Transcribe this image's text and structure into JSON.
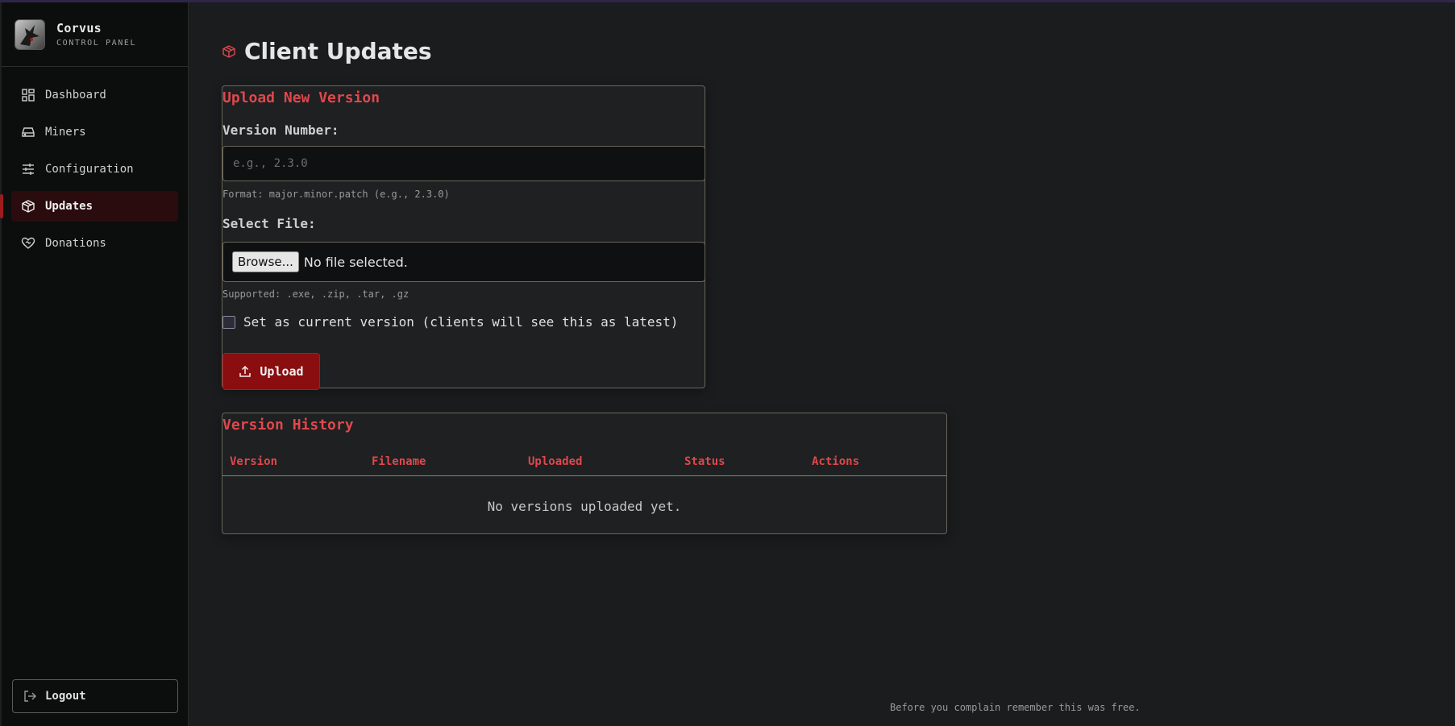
{
  "brand": {
    "name": "Corvus",
    "subtitle": "CONTROL PANEL"
  },
  "sidebar": {
    "items": [
      {
        "label": "Dashboard",
        "icon": "dashboard-icon",
        "active": false
      },
      {
        "label": "Miners",
        "icon": "drive-icon",
        "active": false
      },
      {
        "label": "Configuration",
        "icon": "sliders-icon",
        "active": false
      },
      {
        "label": "Updates",
        "icon": "package-icon",
        "active": true
      },
      {
        "label": "Donations",
        "icon": "heart-handshake-icon",
        "active": false
      }
    ],
    "logout_label": "Logout"
  },
  "page": {
    "title": "Client Updates"
  },
  "upload": {
    "title": "Upload New Version",
    "version_label": "Version Number:",
    "version_placeholder": "e.g., 2.3.0",
    "version_hint": "Format: major.minor.patch (e.g., 2.3.0)",
    "file_label": "Select File:",
    "browse_label": "Browse...",
    "file_status": "No file selected.",
    "file_hint": "Supported: .exe, .zip, .tar, .gz",
    "checkbox_label": "Set as current version (clients will see this as latest)",
    "checkbox_checked": false,
    "submit_label": "Upload"
  },
  "history": {
    "title": "Version History",
    "columns": [
      "Version",
      "Filename",
      "Uploaded",
      "Status",
      "Actions"
    ],
    "empty_message": "No versions uploaded yet."
  },
  "footer": {
    "text": "Before you complain remember this was free."
  },
  "colors": {
    "accent": "#e0474c",
    "button": "#8a0d10",
    "background": "#1b1c1e",
    "sidebar": "#0c0d0d"
  }
}
